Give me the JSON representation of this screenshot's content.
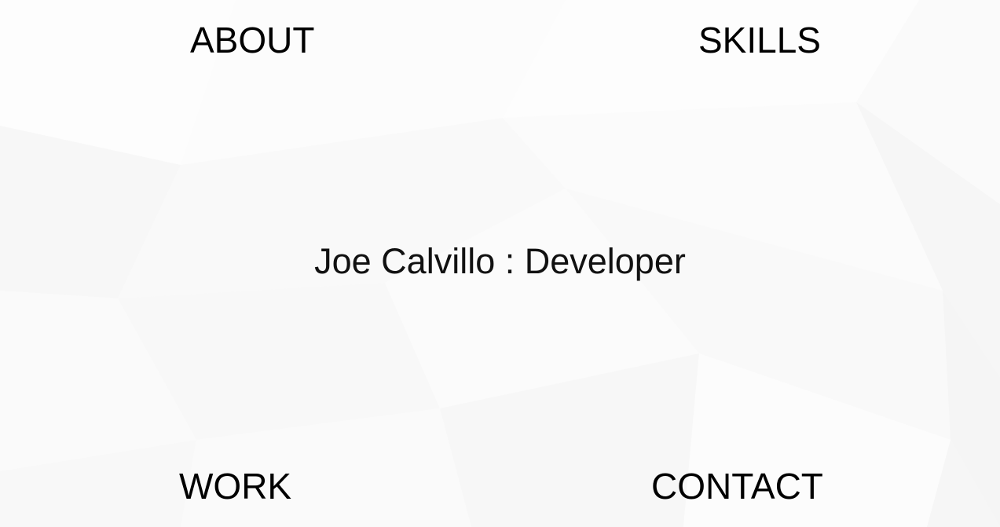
{
  "nav": {
    "about": "ABOUT",
    "skills": "SKILLS",
    "work": "WORK",
    "contact": "CONTACT"
  },
  "hero": {
    "tagline": "Joe Calvillo : Developer"
  },
  "colors": {
    "background": "#fcfcfc",
    "facet_light": "#ffffff",
    "facet_shade": "#f4f4f4",
    "text": "#000000"
  }
}
